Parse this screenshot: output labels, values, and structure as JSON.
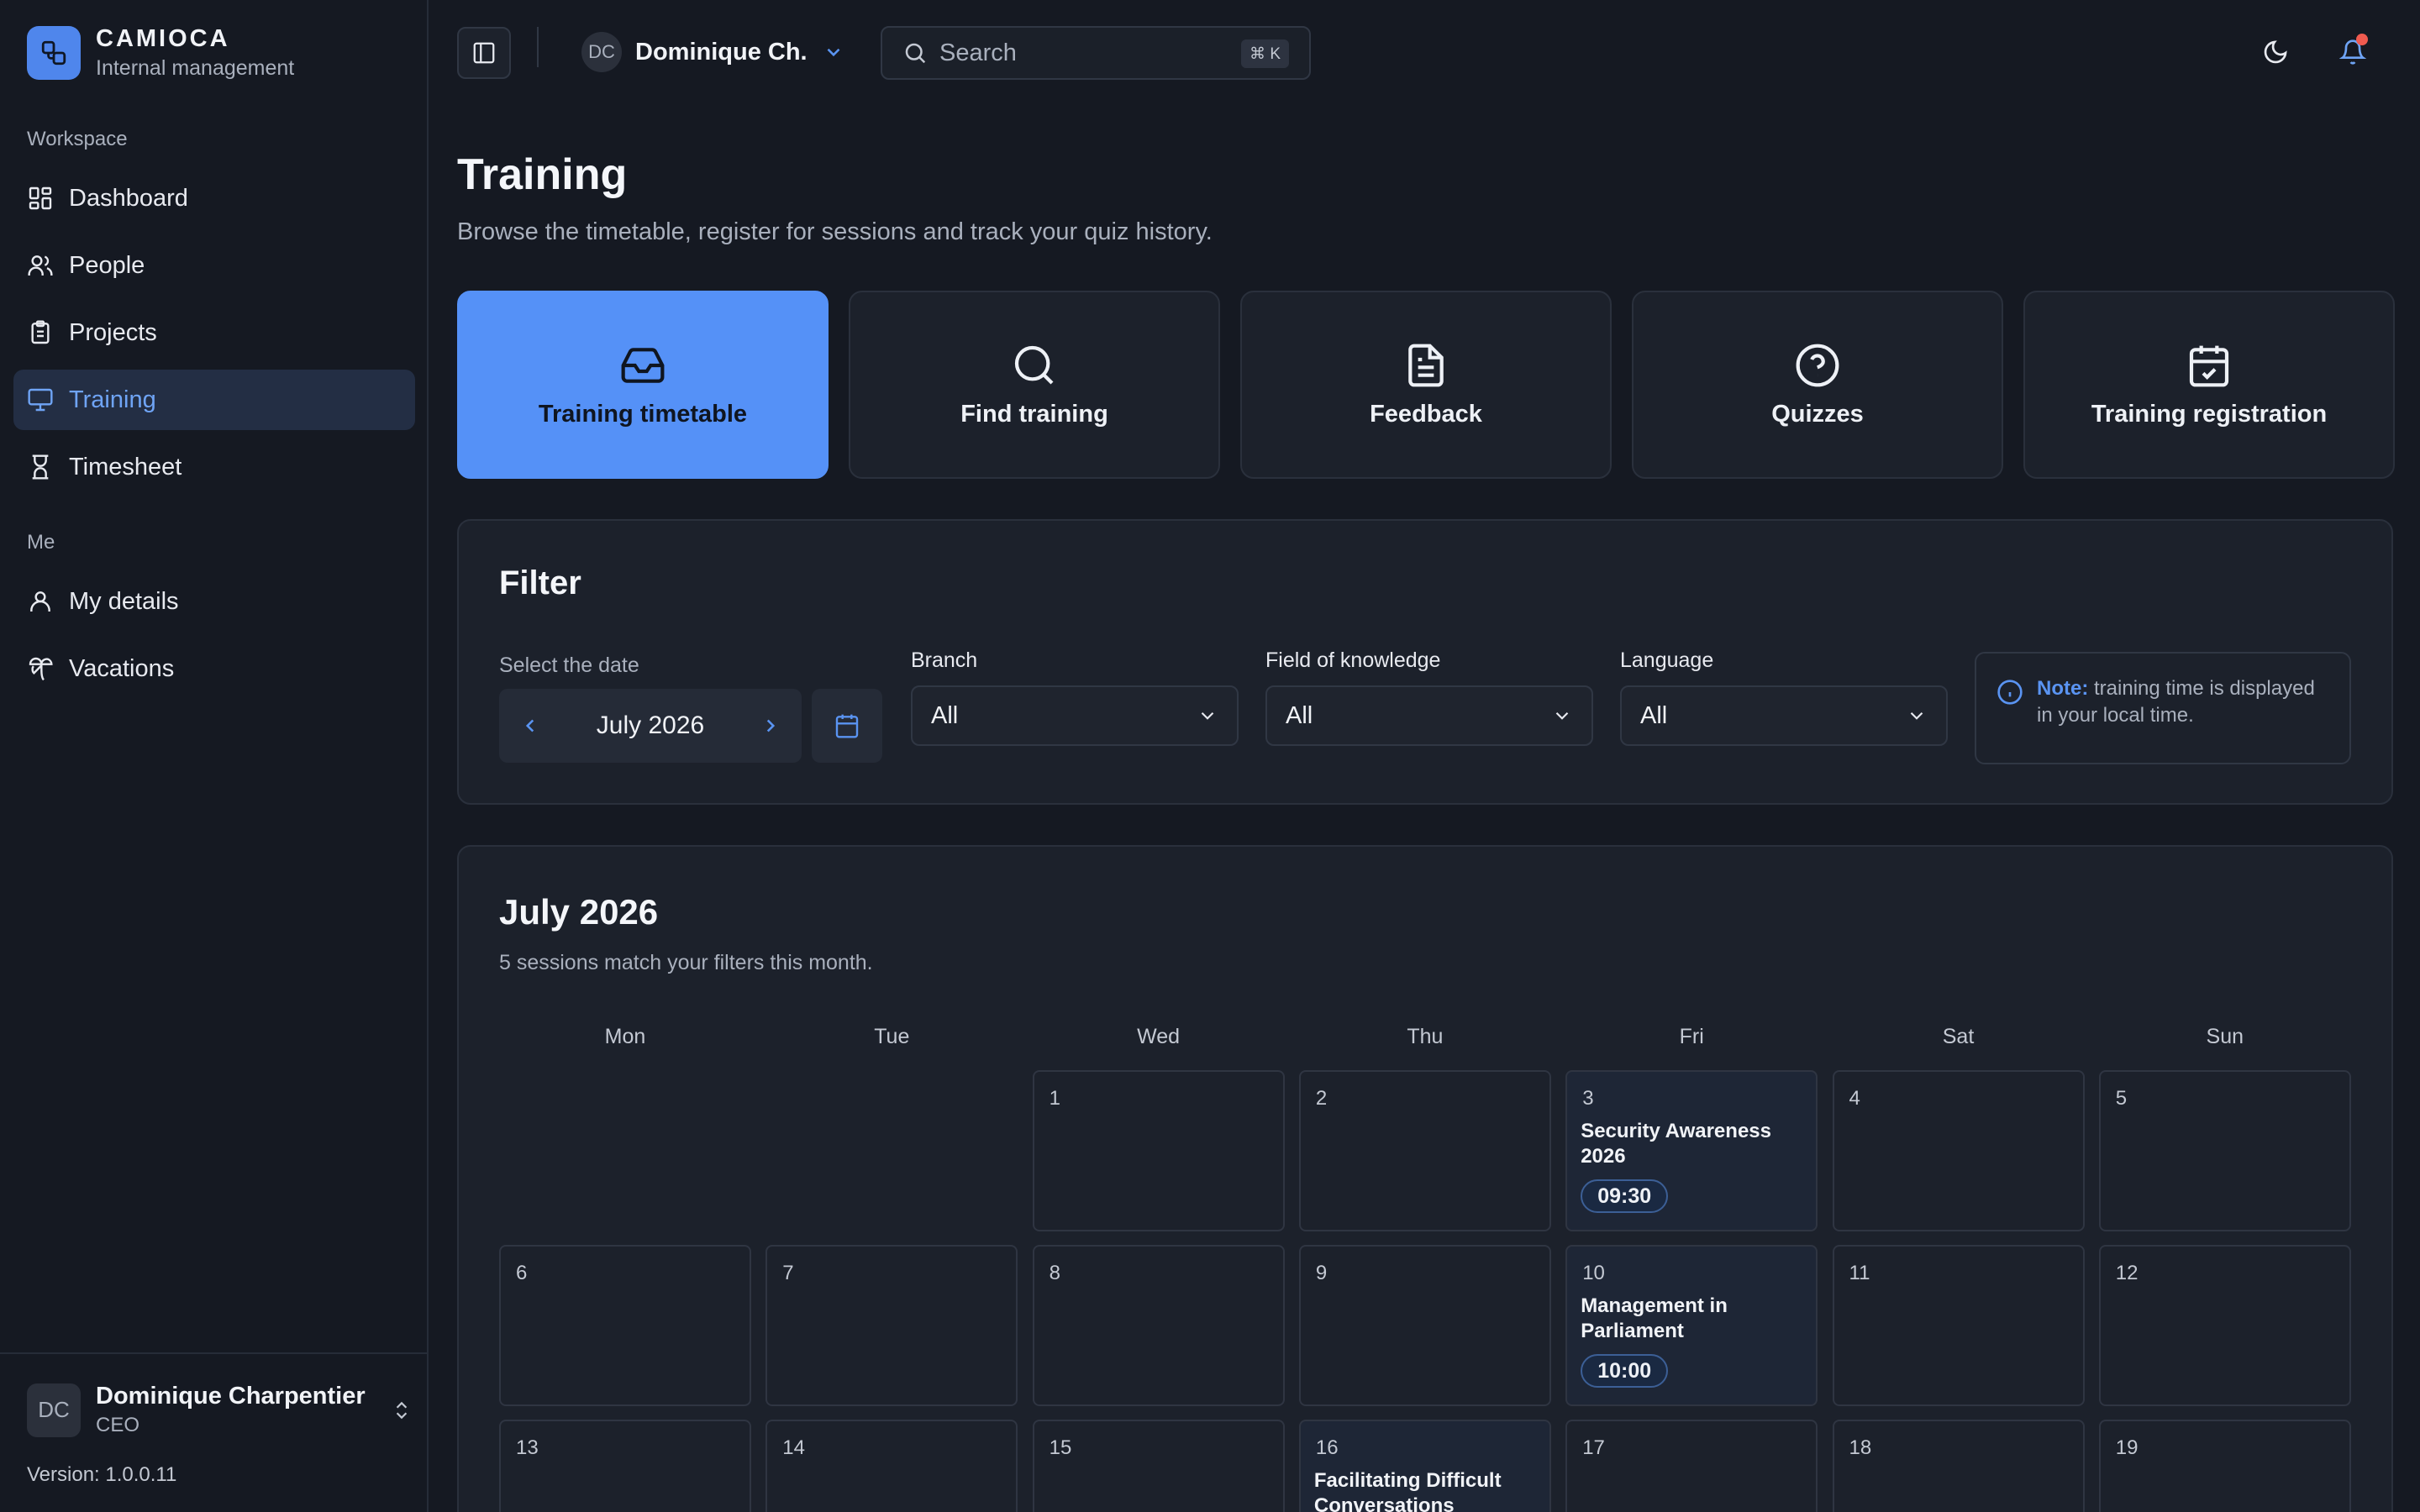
{
  "brand": {
    "name": "CAMIOCA",
    "subtitle": "Internal management"
  },
  "sidebar": {
    "groups": {
      "workspace": "Workspace",
      "me": "Me"
    },
    "items": [
      {
        "label": "Dashboard",
        "icon": "dashboard-icon"
      },
      {
        "label": "People",
        "icon": "users-icon"
      },
      {
        "label": "Projects",
        "icon": "clipboard-icon"
      },
      {
        "label": "Training",
        "icon": "presentation-icon",
        "active": true
      },
      {
        "label": "Timesheet",
        "icon": "hourglass-icon"
      },
      {
        "label": "My details",
        "icon": "user-icon"
      },
      {
        "label": "Vacations",
        "icon": "palm-tree-icon"
      }
    ],
    "user": {
      "initials": "DC",
      "name": "Dominique Charpentier",
      "role": "CEO"
    },
    "version": "Version: 1.0.0.11"
  },
  "topbar": {
    "user_initials": "DC",
    "user_name": "Dominique Ch.",
    "search_placeholder": "Search",
    "search_shortcut": "⌘ K"
  },
  "page": {
    "title": "Training",
    "subtitle": "Browse the timetable, register for sessions and track your quiz history."
  },
  "tiles": [
    {
      "label": "Training timetable",
      "icon": "inbox-icon",
      "active": true
    },
    {
      "label": "Find training",
      "icon": "search-icon"
    },
    {
      "label": "Feedback",
      "icon": "document-icon"
    },
    {
      "label": "Quizzes",
      "icon": "help-circle-icon"
    },
    {
      "label": "Training registration",
      "icon": "calendar-check-icon"
    }
  ],
  "filter": {
    "title": "Filter",
    "date_label": "Select the date",
    "month": "July 2026",
    "branch_label": "Branch",
    "branch_value": "All",
    "field_label": "Field of knowledge",
    "field_value": "All",
    "language_label": "Language",
    "language_value": "All",
    "note_strong": "Note:",
    "note_text": "training time is displayed in your local time."
  },
  "calendar": {
    "title": "July 2026",
    "subtitle": "5 sessions match your filters this month.",
    "weekdays": [
      "Mon",
      "Tue",
      "Wed",
      "Thu",
      "Fri",
      "Sat",
      "Sun"
    ],
    "days": [
      {
        "n": "1",
        "col": 2,
        "row": 0
      },
      {
        "n": "2",
        "col": 3,
        "row": 0
      },
      {
        "n": "3",
        "col": 4,
        "row": 0,
        "event": "Security Awareness 2026",
        "time": "09:30"
      },
      {
        "n": "4",
        "col": 5,
        "row": 0
      },
      {
        "n": "5",
        "col": 6,
        "row": 0
      },
      {
        "n": "6",
        "col": 0,
        "row": 1
      },
      {
        "n": "7",
        "col": 1,
        "row": 1
      },
      {
        "n": "8",
        "col": 2,
        "row": 1
      },
      {
        "n": "9",
        "col": 3,
        "row": 1
      },
      {
        "n": "10",
        "col": 4,
        "row": 1,
        "event": "Management in Parliament",
        "time": "10:00"
      },
      {
        "n": "11",
        "col": 5,
        "row": 1
      },
      {
        "n": "12",
        "col": 6,
        "row": 1
      },
      {
        "n": "13",
        "col": 0,
        "row": 2
      },
      {
        "n": "14",
        "col": 1,
        "row": 2
      },
      {
        "n": "15",
        "col": 2,
        "row": 2
      },
      {
        "n": "16",
        "col": 3,
        "row": 2,
        "event": "Facilitating Difficult Conversations"
      },
      {
        "n": "17",
        "col": 4,
        "row": 2
      },
      {
        "n": "18",
        "col": 5,
        "row": 2
      },
      {
        "n": "19",
        "col": 6,
        "row": 2
      }
    ]
  },
  "colors": {
    "accent": "#5591f7",
    "background": "#151922",
    "card": "#1c212b",
    "notification": "#ef5a4f"
  }
}
